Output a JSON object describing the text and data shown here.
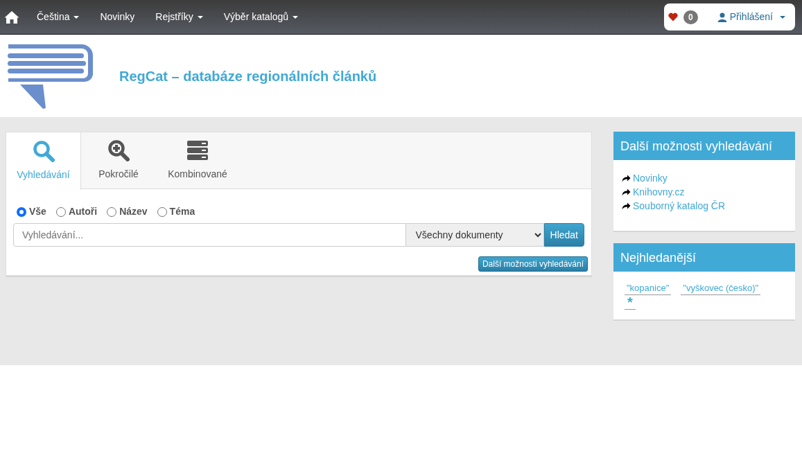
{
  "navbar": {
    "items": [
      {
        "label": "Čeština",
        "dropdown": true
      },
      {
        "label": "Novinky",
        "dropdown": false
      },
      {
        "label": "Rejstříky",
        "dropdown": true
      },
      {
        "label": "Výběr katalogů",
        "dropdown": true
      }
    ],
    "favorites_count": "0",
    "login": "Přihlášení"
  },
  "header": {
    "title": "RegCat – databáze regionálních článků"
  },
  "search": {
    "tabs": [
      {
        "label": "Vyhledávání",
        "kind": "search",
        "selected": true
      },
      {
        "label": "Pokročilé",
        "kind": "advanced",
        "selected": false
      },
      {
        "label": "Kombinované",
        "kind": "combined",
        "selected": false
      }
    ],
    "scopes": [
      {
        "label": "Vše",
        "selected": true
      },
      {
        "label": "Autoři",
        "selected": false
      },
      {
        "label": "Název",
        "selected": false
      },
      {
        "label": "Téma",
        "selected": false
      }
    ],
    "placeholder": "Vyhledávání...",
    "document_type": "Všechny dokumenty",
    "submit": "Hledat",
    "more_button": "Další možnosti vyhledávání"
  },
  "sidebar": [
    {
      "title": "Další možnosti vyhledávání",
      "kind": "links",
      "items": [
        "Novinky",
        "Knihovny.cz",
        "Souborný katalog ČR"
      ]
    },
    {
      "title": "Nejhledanější",
      "kind": "tags",
      "items": [
        "\"kopanice\"",
        "\"vyškovec (česko)\"",
        "*"
      ]
    }
  ]
}
